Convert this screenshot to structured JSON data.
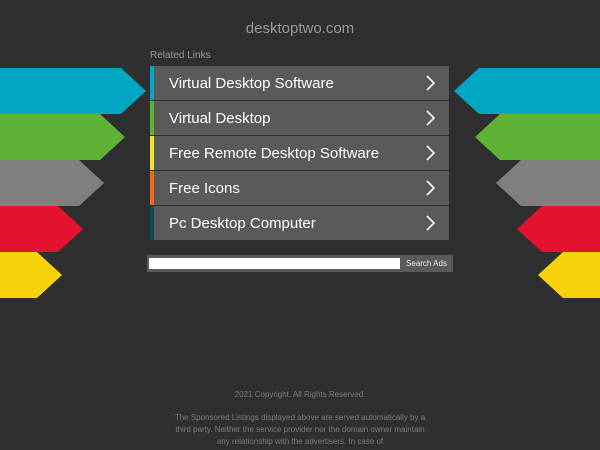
{
  "site": {
    "title": "desktoptwo.com"
  },
  "related_links": {
    "heading": "Related Links",
    "items": [
      {
        "label": "Virtual Desktop Software",
        "color": "#00a7c4"
      },
      {
        "label": "Virtual Desktop",
        "color": "#5eb236"
      },
      {
        "label": "Free Remote Desktop Software",
        "color": "#f1e12b"
      },
      {
        "label": "Free Icons",
        "color": "#f06a1f"
      },
      {
        "label": "Pc Desktop Computer",
        "color": "#0b4a5c"
      }
    ]
  },
  "side_arrows": {
    "colors": [
      "#00a7c4",
      "#5eb236",
      "#7f7f7f",
      "#e4122f",
      "#f7d20a"
    ]
  },
  "search": {
    "placeholder": "",
    "value": "",
    "button_label": "Search Ads"
  },
  "footer": {
    "copyright": "2021 Copyright. All Rights Reserved.",
    "disclaimer": "The Sponsored Listings displayed above are served automatically by a third party. Neither the service provider nor the domain owner maintain any relationship with the advertisers. In case of"
  },
  "icons": {
    "chevron": "chevron-right-icon"
  }
}
